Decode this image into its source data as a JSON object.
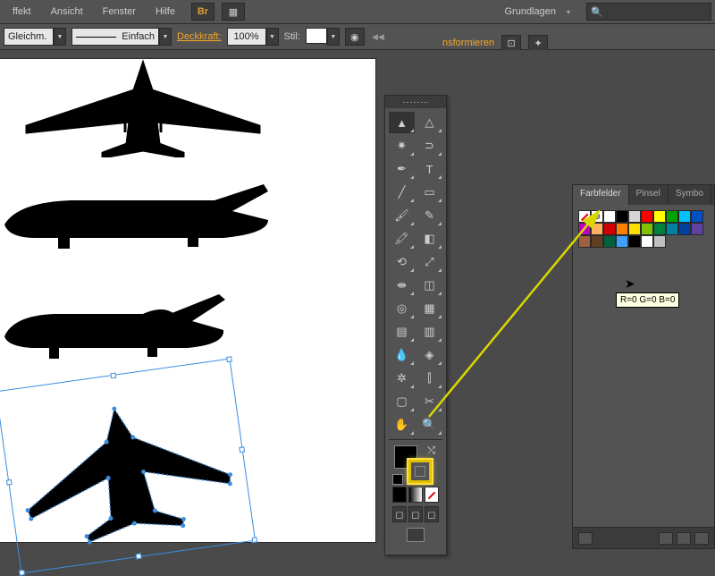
{
  "menu": {
    "items": [
      "ffekt",
      "Ansicht",
      "Fenster",
      "Hilfe"
    ],
    "workspace": "Grundlagen"
  },
  "opt": {
    "uniform": "Gleichm.",
    "stroke_style": "Einfach",
    "opacity_label": "Deckkraft:",
    "opacity_value": "100%",
    "style_label": "Stil:"
  },
  "ctx": {
    "transform": "nsformieren"
  },
  "swatches": {
    "tab1": "Farbfelder",
    "tab2": "Pinsel",
    "tab3": "Symbo",
    "tooltip": "R=0 G=0 B=0",
    "colors": [
      "#ffffff",
      "#000000",
      "#d6d6d6",
      "#ff0000",
      "#ffff00",
      "#00a000",
      "#00c0ff",
      "#0050c0",
      "#c000c0",
      "#ffb060",
      "#d00000",
      "#ff8000",
      "#ffe000",
      "#80c000",
      "#008040",
      "#0080a0",
      "#0040a0",
      "#6040a0",
      "#a06040",
      "#604020",
      "#006040",
      "#40a0ff",
      "#000000",
      "#ffffff",
      "#c0c0c0"
    ]
  },
  "br_label": "Br"
}
